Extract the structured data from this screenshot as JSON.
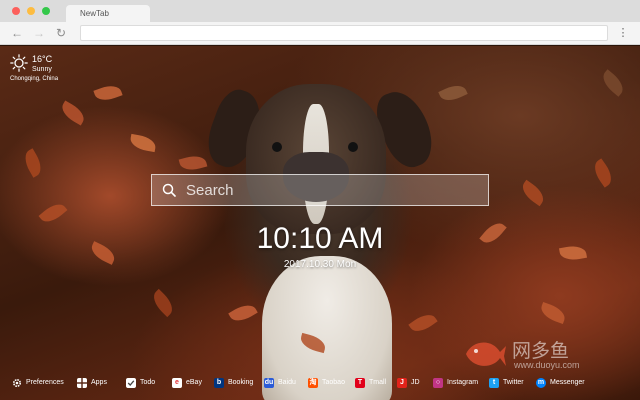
{
  "browser": {
    "tab_title": "NewTab",
    "url": ""
  },
  "weather": {
    "temperature": "16°C",
    "condition": "Sunny",
    "location": "Chongqing,  China",
    "icon": "sun-icon"
  },
  "search": {
    "placeholder": "Search"
  },
  "clock": {
    "time": "10:10 AM",
    "date": "2017.10.30 Mon"
  },
  "watermark": {
    "text": "网多鱼",
    "url": "www.duoyu.com"
  },
  "dock": {
    "items": [
      {
        "label": "Preferences",
        "icon": "gear-icon",
        "color": "#333333"
      },
      {
        "label": "Apps",
        "icon": "grid-icon",
        "color": "#ffffff"
      },
      {
        "label": "Todo",
        "icon": "checkbox-icon",
        "color": "#ffffff"
      },
      {
        "label": "eBay",
        "icon": "ebay-icon",
        "color": "#ffffff"
      },
      {
        "label": "Booking",
        "icon": "booking-icon",
        "color": "#003580"
      },
      {
        "label": "Baidu",
        "icon": "baidu-icon",
        "color": "#2a5bd7"
      },
      {
        "label": "Taobao",
        "icon": "taobao-icon",
        "color": "#ff5000"
      },
      {
        "label": "Tmall",
        "icon": "tmall-icon",
        "color": "#e1001a"
      },
      {
        "label": "JD",
        "icon": "jd-icon",
        "color": "#e2231a"
      },
      {
        "label": "Instagram",
        "icon": "instagram-icon",
        "color": "#c13584"
      },
      {
        "label": "Twitter",
        "icon": "twitter-icon",
        "color": "#1da1f2"
      },
      {
        "label": "Messenger",
        "icon": "messenger-icon",
        "color": "#0084ff"
      }
    ]
  }
}
